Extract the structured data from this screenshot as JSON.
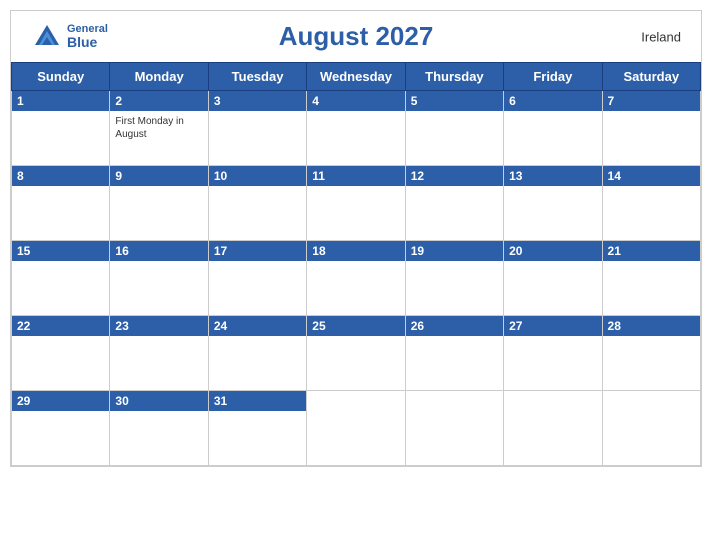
{
  "header": {
    "logo_general": "General",
    "logo_blue": "Blue",
    "title": "August 2027",
    "country": "Ireland"
  },
  "days_of_week": [
    "Sunday",
    "Monday",
    "Tuesday",
    "Wednesday",
    "Thursday",
    "Friday",
    "Saturday"
  ],
  "weeks": [
    [
      {
        "date": "1",
        "holiday": ""
      },
      {
        "date": "2",
        "holiday": "First Monday in\nAugust"
      },
      {
        "date": "3",
        "holiday": ""
      },
      {
        "date": "4",
        "holiday": ""
      },
      {
        "date": "5",
        "holiday": ""
      },
      {
        "date": "6",
        "holiday": ""
      },
      {
        "date": "7",
        "holiday": ""
      }
    ],
    [
      {
        "date": "8",
        "holiday": ""
      },
      {
        "date": "9",
        "holiday": ""
      },
      {
        "date": "10",
        "holiday": ""
      },
      {
        "date": "11",
        "holiday": ""
      },
      {
        "date": "12",
        "holiday": ""
      },
      {
        "date": "13",
        "holiday": ""
      },
      {
        "date": "14",
        "holiday": ""
      }
    ],
    [
      {
        "date": "15",
        "holiday": ""
      },
      {
        "date": "16",
        "holiday": ""
      },
      {
        "date": "17",
        "holiday": ""
      },
      {
        "date": "18",
        "holiday": ""
      },
      {
        "date": "19",
        "holiday": ""
      },
      {
        "date": "20",
        "holiday": ""
      },
      {
        "date": "21",
        "holiday": ""
      }
    ],
    [
      {
        "date": "22",
        "holiday": ""
      },
      {
        "date": "23",
        "holiday": ""
      },
      {
        "date": "24",
        "holiday": ""
      },
      {
        "date": "25",
        "holiday": ""
      },
      {
        "date": "26",
        "holiday": ""
      },
      {
        "date": "27",
        "holiday": ""
      },
      {
        "date": "28",
        "holiday": ""
      }
    ],
    [
      {
        "date": "29",
        "holiday": ""
      },
      {
        "date": "30",
        "holiday": ""
      },
      {
        "date": "31",
        "holiday": ""
      },
      {
        "date": "",
        "holiday": ""
      },
      {
        "date": "",
        "holiday": ""
      },
      {
        "date": "",
        "holiday": ""
      },
      {
        "date": "",
        "holiday": ""
      }
    ]
  ],
  "colors": {
    "header_blue": "#2c5fa8",
    "text_dark": "#333333",
    "border": "#cccccc",
    "white": "#ffffff"
  }
}
